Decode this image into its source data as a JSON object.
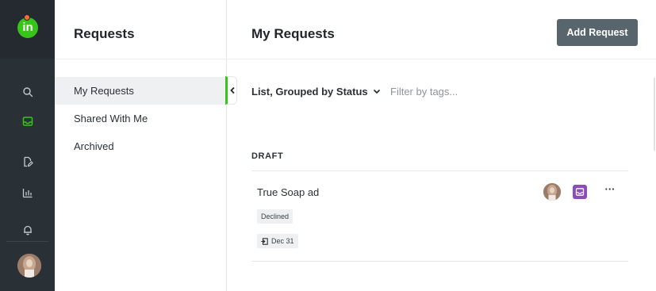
{
  "brand": {
    "logo_text": "in",
    "logo_color": "#37c51a",
    "logo_dot_color": "#ff6a2f"
  },
  "rail": {
    "items": [
      {
        "icon": "search-icon"
      },
      {
        "icon": "inbox-icon",
        "active": true,
        "active_color": "#37c51a"
      },
      {
        "icon": "edit-document-icon"
      },
      {
        "icon": "bar-chart-icon"
      },
      {
        "icon": "bell-icon"
      }
    ],
    "avatar": "user-avatar"
  },
  "sidebar": {
    "title": "Requests",
    "items": [
      {
        "label": "My Requests",
        "active": true
      },
      {
        "label": "Shared With Me"
      },
      {
        "label": "Archived"
      }
    ]
  },
  "main": {
    "title": "My Requests",
    "add_button_label": "Add Request",
    "view_label": "List, Grouped by Status",
    "tag_filter_placeholder": "Filter by tags...",
    "groups": [
      {
        "label": "DRAFT",
        "requests": [
          {
            "title": "True Soap ad",
            "status": "Declined",
            "due_date": "Dec 31",
            "badge_color": "#8b4db8"
          }
        ]
      }
    ]
  }
}
